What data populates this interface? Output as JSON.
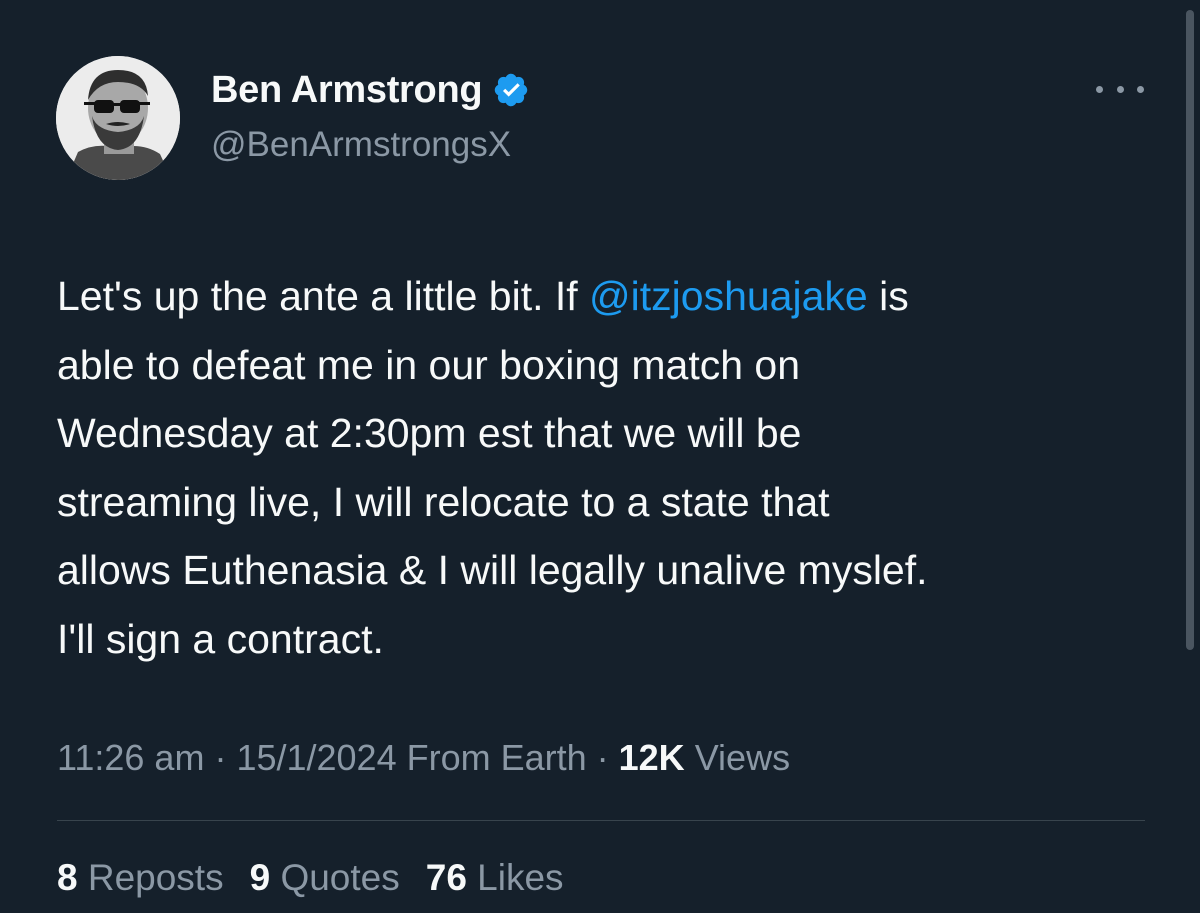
{
  "author": {
    "display_name": "Ben Armstrong",
    "handle": "@BenArmstrongsX",
    "verified": true
  },
  "tweet": {
    "lines": [
      {
        "before": "Let's up the ante a little bit. If ",
        "mention": "@itzjoshuajake",
        "after": " is"
      },
      {
        "text": "able to defeat me in our boxing match on"
      },
      {
        "text": "Wednesday at 2:30pm est that we will be"
      },
      {
        "text": "streaming live, I will relocate to a state that"
      },
      {
        "text": "allows Euthenasia & I will legally unalive myslef."
      },
      {
        "text": "I'll sign a contract."
      }
    ]
  },
  "meta": {
    "time": "11:26 am",
    "separator": " · ",
    "date_source": "15/1/2024 From Earth",
    "views_count": "12K",
    "views_label": " Views"
  },
  "stats": [
    {
      "count": "8",
      "label": " Reposts"
    },
    {
      "count": "9",
      "label": " Quotes"
    },
    {
      "count": "76",
      "label": " Likes"
    }
  ],
  "colors": {
    "background": "#15202b",
    "text": "#f7f9f9",
    "secondary": "#8b98a5",
    "accent": "#1d9bf0"
  },
  "icons": {
    "verified": "verified-badge-icon",
    "more": "more-options-icon"
  }
}
